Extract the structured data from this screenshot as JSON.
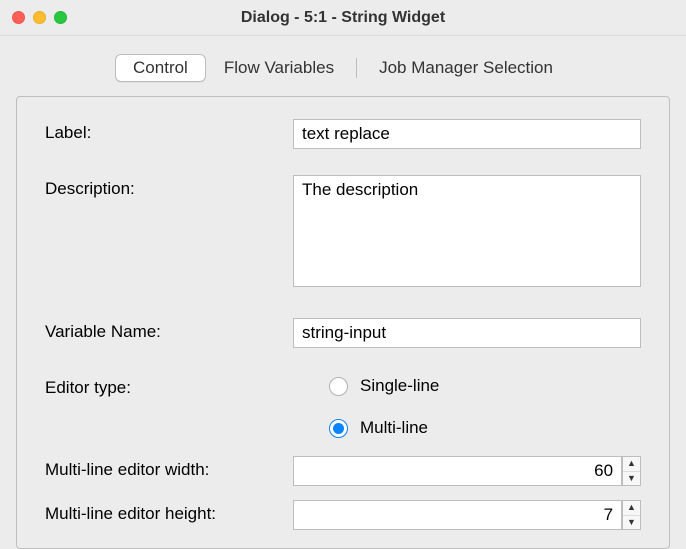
{
  "window": {
    "title": "Dialog - 5:1 - String Widget"
  },
  "tabs": {
    "control": "Control",
    "flow_variables": "Flow Variables",
    "job_manager": "Job Manager Selection"
  },
  "form": {
    "label_caption": "Label:",
    "label_value": "text replace",
    "description_caption": "Description:",
    "description_value": "The description",
    "varname_caption": "Variable Name:",
    "varname_value": "string-input",
    "editor_type_caption": "Editor type:",
    "editor_type_single": "Single-line",
    "editor_type_multi": "Multi-line",
    "width_caption": "Multi-line editor width:",
    "width_value": "60",
    "height_caption": "Multi-line editor height:",
    "height_value": "7"
  }
}
